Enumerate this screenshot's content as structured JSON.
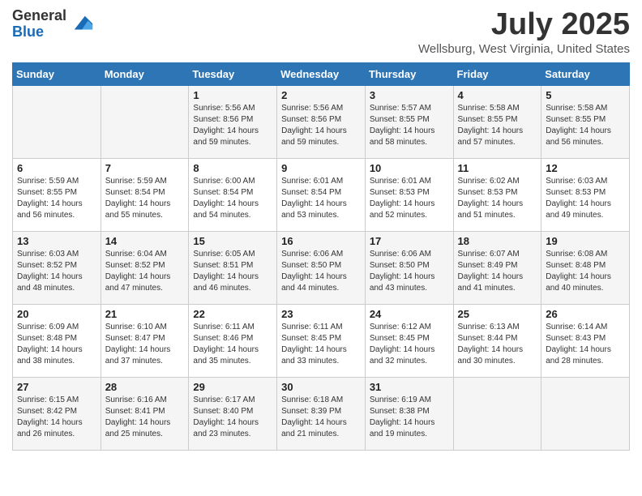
{
  "header": {
    "logo_general": "General",
    "logo_blue": "Blue",
    "month_title": "July 2025",
    "location": "Wellsburg, West Virginia, United States"
  },
  "days_of_week": [
    "Sunday",
    "Monday",
    "Tuesday",
    "Wednesday",
    "Thursday",
    "Friday",
    "Saturday"
  ],
  "weeks": [
    [
      {
        "day": "",
        "sunrise": "",
        "sunset": "",
        "daylight": ""
      },
      {
        "day": "",
        "sunrise": "",
        "sunset": "",
        "daylight": ""
      },
      {
        "day": "1",
        "sunrise": "Sunrise: 5:56 AM",
        "sunset": "Sunset: 8:56 PM",
        "daylight": "Daylight: 14 hours and 59 minutes."
      },
      {
        "day": "2",
        "sunrise": "Sunrise: 5:56 AM",
        "sunset": "Sunset: 8:56 PM",
        "daylight": "Daylight: 14 hours and 59 minutes."
      },
      {
        "day": "3",
        "sunrise": "Sunrise: 5:57 AM",
        "sunset": "Sunset: 8:55 PM",
        "daylight": "Daylight: 14 hours and 58 minutes."
      },
      {
        "day": "4",
        "sunrise": "Sunrise: 5:58 AM",
        "sunset": "Sunset: 8:55 PM",
        "daylight": "Daylight: 14 hours and 57 minutes."
      },
      {
        "day": "5",
        "sunrise": "Sunrise: 5:58 AM",
        "sunset": "Sunset: 8:55 PM",
        "daylight": "Daylight: 14 hours and 56 minutes."
      }
    ],
    [
      {
        "day": "6",
        "sunrise": "Sunrise: 5:59 AM",
        "sunset": "Sunset: 8:55 PM",
        "daylight": "Daylight: 14 hours and 56 minutes."
      },
      {
        "day": "7",
        "sunrise": "Sunrise: 5:59 AM",
        "sunset": "Sunset: 8:54 PM",
        "daylight": "Daylight: 14 hours and 55 minutes."
      },
      {
        "day": "8",
        "sunrise": "Sunrise: 6:00 AM",
        "sunset": "Sunset: 8:54 PM",
        "daylight": "Daylight: 14 hours and 54 minutes."
      },
      {
        "day": "9",
        "sunrise": "Sunrise: 6:01 AM",
        "sunset": "Sunset: 8:54 PM",
        "daylight": "Daylight: 14 hours and 53 minutes."
      },
      {
        "day": "10",
        "sunrise": "Sunrise: 6:01 AM",
        "sunset": "Sunset: 8:53 PM",
        "daylight": "Daylight: 14 hours and 52 minutes."
      },
      {
        "day": "11",
        "sunrise": "Sunrise: 6:02 AM",
        "sunset": "Sunset: 8:53 PM",
        "daylight": "Daylight: 14 hours and 51 minutes."
      },
      {
        "day": "12",
        "sunrise": "Sunrise: 6:03 AM",
        "sunset": "Sunset: 8:53 PM",
        "daylight": "Daylight: 14 hours and 49 minutes."
      }
    ],
    [
      {
        "day": "13",
        "sunrise": "Sunrise: 6:03 AM",
        "sunset": "Sunset: 8:52 PM",
        "daylight": "Daylight: 14 hours and 48 minutes."
      },
      {
        "day": "14",
        "sunrise": "Sunrise: 6:04 AM",
        "sunset": "Sunset: 8:52 PM",
        "daylight": "Daylight: 14 hours and 47 minutes."
      },
      {
        "day": "15",
        "sunrise": "Sunrise: 6:05 AM",
        "sunset": "Sunset: 8:51 PM",
        "daylight": "Daylight: 14 hours and 46 minutes."
      },
      {
        "day": "16",
        "sunrise": "Sunrise: 6:06 AM",
        "sunset": "Sunset: 8:50 PM",
        "daylight": "Daylight: 14 hours and 44 minutes."
      },
      {
        "day": "17",
        "sunrise": "Sunrise: 6:06 AM",
        "sunset": "Sunset: 8:50 PM",
        "daylight": "Daylight: 14 hours and 43 minutes."
      },
      {
        "day": "18",
        "sunrise": "Sunrise: 6:07 AM",
        "sunset": "Sunset: 8:49 PM",
        "daylight": "Daylight: 14 hours and 41 minutes."
      },
      {
        "day": "19",
        "sunrise": "Sunrise: 6:08 AM",
        "sunset": "Sunset: 8:48 PM",
        "daylight": "Daylight: 14 hours and 40 minutes."
      }
    ],
    [
      {
        "day": "20",
        "sunrise": "Sunrise: 6:09 AM",
        "sunset": "Sunset: 8:48 PM",
        "daylight": "Daylight: 14 hours and 38 minutes."
      },
      {
        "day": "21",
        "sunrise": "Sunrise: 6:10 AM",
        "sunset": "Sunset: 8:47 PM",
        "daylight": "Daylight: 14 hours and 37 minutes."
      },
      {
        "day": "22",
        "sunrise": "Sunrise: 6:11 AM",
        "sunset": "Sunset: 8:46 PM",
        "daylight": "Daylight: 14 hours and 35 minutes."
      },
      {
        "day": "23",
        "sunrise": "Sunrise: 6:11 AM",
        "sunset": "Sunset: 8:45 PM",
        "daylight": "Daylight: 14 hours and 33 minutes."
      },
      {
        "day": "24",
        "sunrise": "Sunrise: 6:12 AM",
        "sunset": "Sunset: 8:45 PM",
        "daylight": "Daylight: 14 hours and 32 minutes."
      },
      {
        "day": "25",
        "sunrise": "Sunrise: 6:13 AM",
        "sunset": "Sunset: 8:44 PM",
        "daylight": "Daylight: 14 hours and 30 minutes."
      },
      {
        "day": "26",
        "sunrise": "Sunrise: 6:14 AM",
        "sunset": "Sunset: 8:43 PM",
        "daylight": "Daylight: 14 hours and 28 minutes."
      }
    ],
    [
      {
        "day": "27",
        "sunrise": "Sunrise: 6:15 AM",
        "sunset": "Sunset: 8:42 PM",
        "daylight": "Daylight: 14 hours and 26 minutes."
      },
      {
        "day": "28",
        "sunrise": "Sunrise: 6:16 AM",
        "sunset": "Sunset: 8:41 PM",
        "daylight": "Daylight: 14 hours and 25 minutes."
      },
      {
        "day": "29",
        "sunrise": "Sunrise: 6:17 AM",
        "sunset": "Sunset: 8:40 PM",
        "daylight": "Daylight: 14 hours and 23 minutes."
      },
      {
        "day": "30",
        "sunrise": "Sunrise: 6:18 AM",
        "sunset": "Sunset: 8:39 PM",
        "daylight": "Daylight: 14 hours and 21 minutes."
      },
      {
        "day": "31",
        "sunrise": "Sunrise: 6:19 AM",
        "sunset": "Sunset: 8:38 PM",
        "daylight": "Daylight: 14 hours and 19 minutes."
      },
      {
        "day": "",
        "sunrise": "",
        "sunset": "",
        "daylight": ""
      },
      {
        "day": "",
        "sunrise": "",
        "sunset": "",
        "daylight": ""
      }
    ]
  ]
}
